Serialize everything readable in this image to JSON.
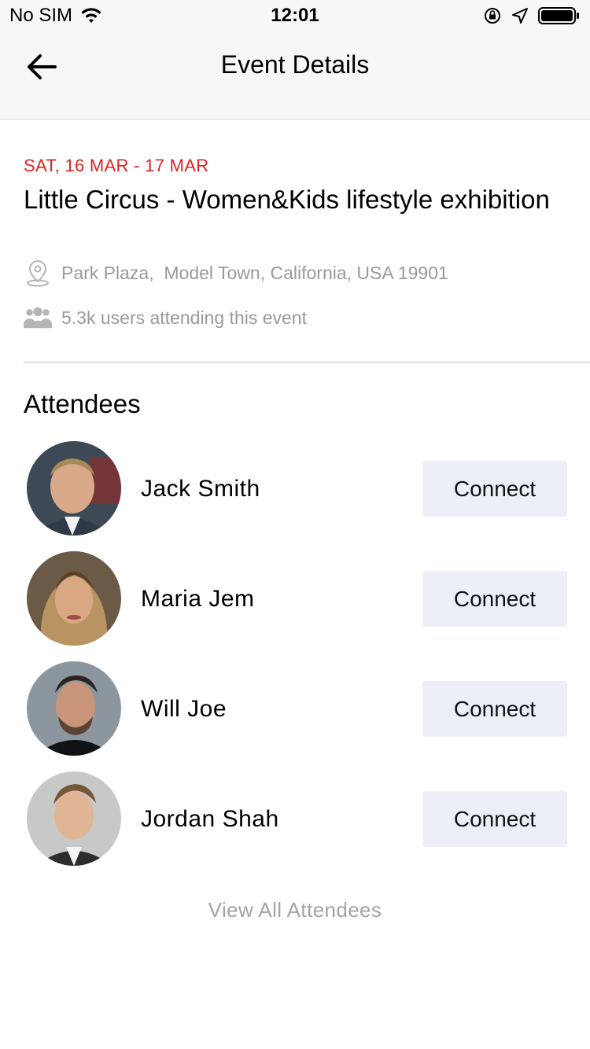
{
  "status_bar": {
    "carrier": "No SIM",
    "time": "12:01"
  },
  "nav": {
    "title": "Event Details"
  },
  "event": {
    "date": "SAT, 16 MAR - 17 MAR",
    "title": "Little Circus - Women&Kids lifestyle exhibition",
    "location": "Park Plaza,  Model Town, California, USA 19901",
    "attending": "5.3k users attending this event"
  },
  "attendees": {
    "heading": "Attendees",
    "items": [
      {
        "name": "Jack Smith",
        "action": "Connect"
      },
      {
        "name": "Maria Jem",
        "action": "Connect"
      },
      {
        "name": "Will Joe",
        "action": "Connect"
      },
      {
        "name": "Jordan Shah",
        "action": "Connect"
      }
    ],
    "view_all": "View All Attendees"
  },
  "colors": {
    "date_red": "#e02020",
    "muted_gray": "#9a9a9a",
    "button_bg": "#edeff8",
    "bar_bg": "#f7f7f7"
  }
}
